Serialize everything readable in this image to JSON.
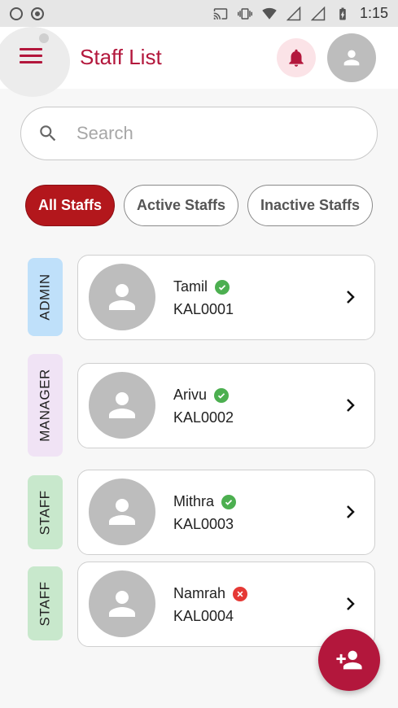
{
  "status_bar": {
    "time": "1:15"
  },
  "header": {
    "title": "Staff List"
  },
  "search": {
    "placeholder": "Search",
    "value": ""
  },
  "filters": [
    {
      "label": "All Staffs",
      "active": true
    },
    {
      "label": "Active Staffs",
      "active": false
    },
    {
      "label": "Inactive Staffs",
      "active": false
    }
  ],
  "staff": [
    {
      "role": "ADMIN",
      "role_color": "#bfe0fa",
      "name": "Tamil",
      "code": "KAL0001",
      "status": "active"
    },
    {
      "role": "MANAGER",
      "role_color": "#f0e3f5",
      "name": "Arivu",
      "code": "KAL0002",
      "status": "active"
    },
    {
      "role": "STAFF",
      "role_color": "#c8e8cc",
      "name": "Mithra",
      "code": "KAL0003",
      "status": "active"
    },
    {
      "role": "STAFF",
      "role_color": "#c8e8cc",
      "name": "Namrah",
      "code": "KAL0004",
      "status": "inactive"
    }
  ],
  "colors": {
    "brand": "#b3173c",
    "chip_active": "#b3171c",
    "status_active": "#4caf50",
    "status_inactive": "#e53935"
  },
  "icons": {
    "menu": "menu-icon",
    "bell": "bell-icon",
    "profile": "person-icon",
    "search": "search-icon",
    "chevron": "chevron-right-icon",
    "fab": "person-add-icon"
  }
}
